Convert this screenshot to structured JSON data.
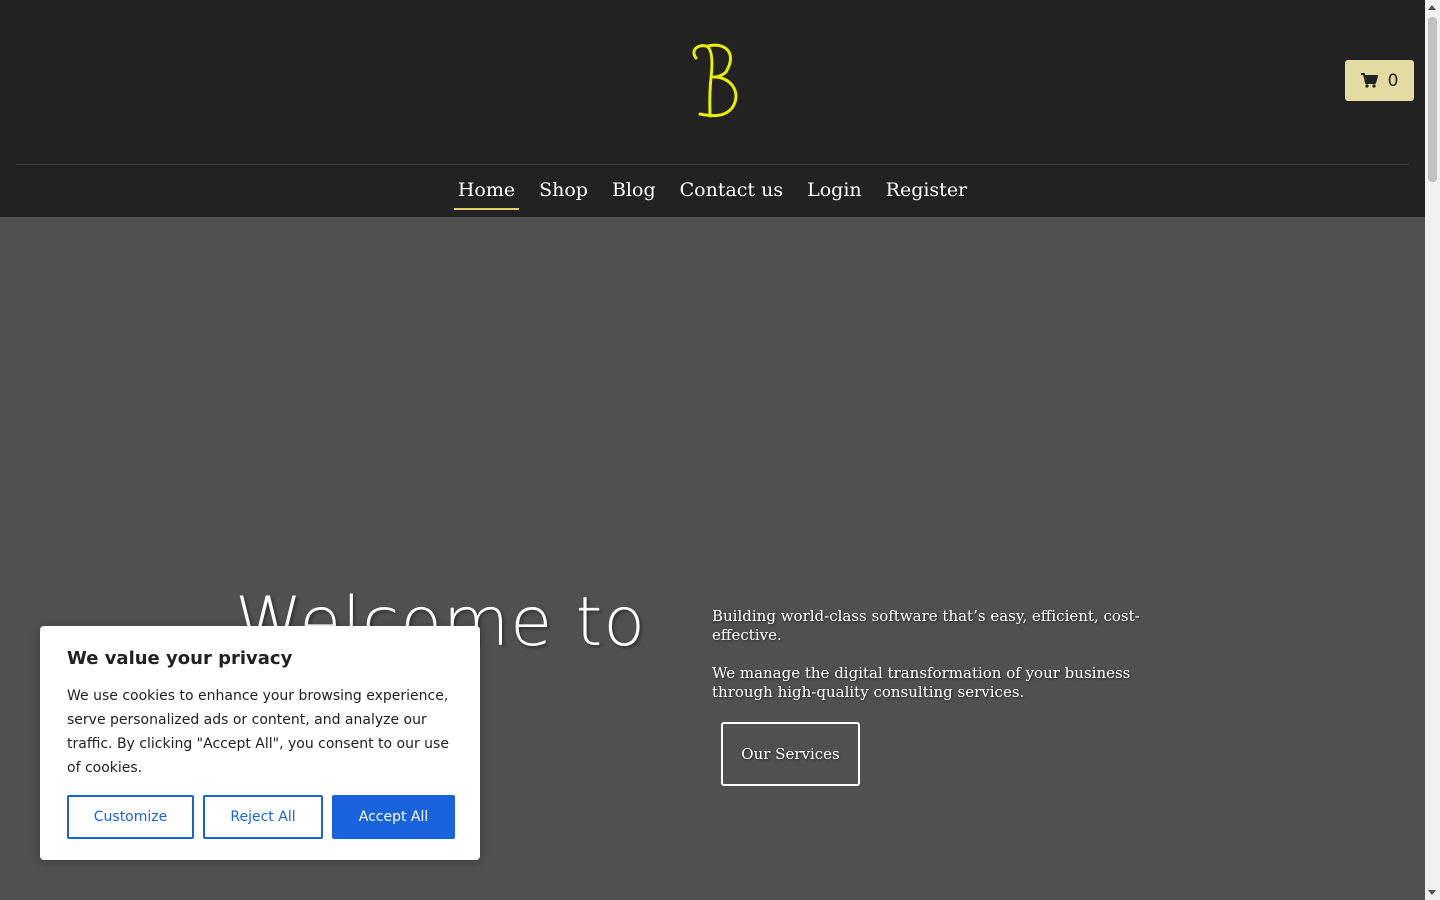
{
  "header": {
    "logo_icon": "script-b-logo",
    "logo_color": "#e8f000",
    "cart": {
      "icon": "cart-icon",
      "count": "0"
    }
  },
  "nav": {
    "items": [
      {
        "label": "Home",
        "active": true
      },
      {
        "label": "Shop"
      },
      {
        "label": "Blog"
      },
      {
        "label": "Contact us"
      },
      {
        "label": "Login"
      },
      {
        "label": "Register"
      }
    ],
    "active_underline_color": "#e6cc6a"
  },
  "hero": {
    "title": "Welcome to",
    "paragraph_1": "Building world-class software that’s easy, efficient, cost-effective.",
    "paragraph_2": "We manage the digital transformation of your business through high-quality consulting services.",
    "cta_label": "Our Services"
  },
  "cookie_banner": {
    "title": "We value your privacy",
    "text": "We use cookies to enhance your browsing experience, serve personalized ads or content, and analyze our traffic. By clicking \"Accept All\", you consent to our use of cookies.",
    "customize_label": "Customize",
    "reject_label": "Reject All",
    "accept_label": "Accept All",
    "accent_color": "#1863dc"
  },
  "colors": {
    "header_bg": "#222222",
    "hero_bg": "#505050",
    "cart_bg": "#e3dca2"
  }
}
